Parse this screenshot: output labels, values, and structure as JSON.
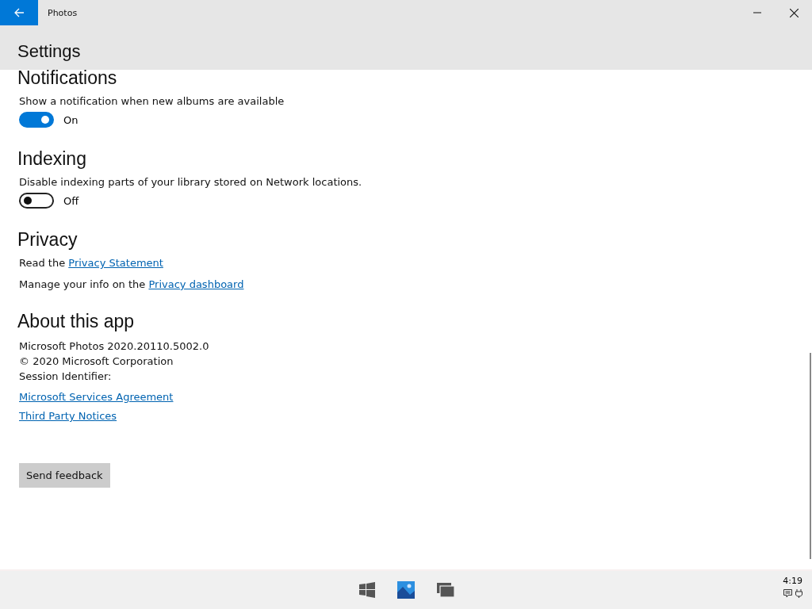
{
  "window": {
    "title": "Photos"
  },
  "header": {
    "title": "Settings"
  },
  "sections": [
    {
      "kind": "toggle",
      "title": "Notifications",
      "label": "Show a notification when new albums are available",
      "on": true,
      "state_text": "On"
    },
    {
      "kind": "toggle",
      "title": "Indexing",
      "label": "Disable indexing parts of your library stored on Network locations.",
      "on": false,
      "state_text": "Off"
    },
    {
      "kind": "links",
      "title": "Privacy",
      "lines": [
        {
          "prefix": "Read the ",
          "link": "Privacy Statement"
        },
        {
          "prefix": "Manage your info on the ",
          "link": "Privacy dashboard"
        }
      ]
    },
    {
      "kind": "about",
      "title": "About this app",
      "info": [
        "Microsoft Photos 2020.20110.5002.0",
        "© 2020 Microsoft Corporation",
        "Session Identifier:"
      ],
      "links": [
        "Microsoft Services Agreement",
        "Third Party Notices"
      ]
    }
  ],
  "feedback_button": "Send feedback",
  "taskbar": {
    "time": "4:19"
  }
}
